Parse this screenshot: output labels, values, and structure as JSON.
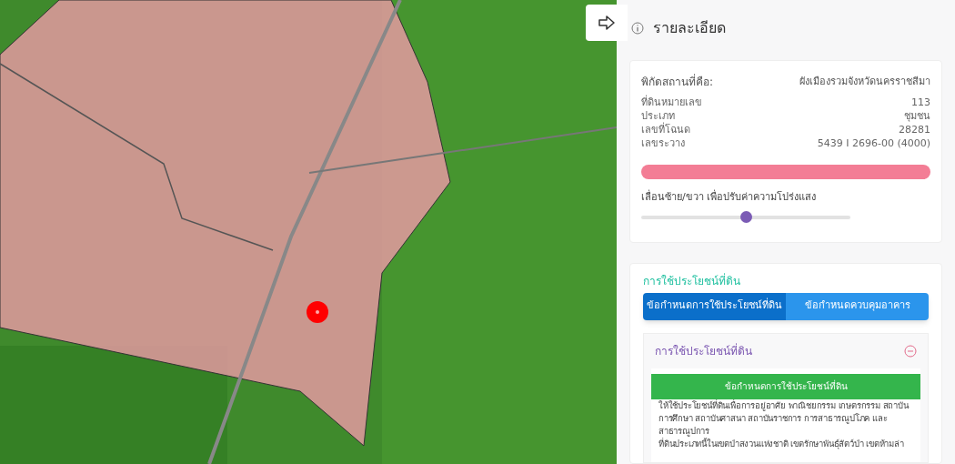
{
  "panel": {
    "title": "รายละเอียด"
  },
  "location": {
    "label": "พิกัดสถานที่คือ:",
    "value": "ผังเมืองรวมจังหวัดนครราชสีมา"
  },
  "details": [
    {
      "label": "ที่ดินหมายเลข",
      "value": "113"
    },
    {
      "label": "ประเภท",
      "value": "ชุมชน"
    },
    {
      "label": "เลขที่โฉนด",
      "value": "28281"
    },
    {
      "label": "เลขระวาง",
      "value": "5439 I 2696-00 (4000)"
    }
  ],
  "opacity": {
    "label": "เลื่อนซ้าย/ขวา เพื่อปรับค่าความโปร่งแสง",
    "level": 0.5
  },
  "land_use": {
    "title": "การใช้ประโยชน์ที่ดิน",
    "tabs": [
      {
        "label": "ข้อกำหนดการใช้ประโยชน์ที่ดิน",
        "selected": true
      },
      {
        "label": "ข้อกำหนดควบคุมอาคาร",
        "selected": false
      }
    ],
    "section": {
      "title": "การใช้ประโยชน์ที่ดิน",
      "expanded": true,
      "heading": "ข้อกำหนดการใช้ประโยชน์ที่ดิน",
      "paragraphs": [
        "ให้ใช้ประโยชน์ที่ดินเพื่อการอยู่อาศัย พาณิชยกรรม เกษตรกรรม สถาบันการศึกษา สถาบันศาสนา สถาบันราชการ การสาธารณูปโภค และสาธารณูปการ",
        "ที่ดินประเภทนี้ในเขตป่าสงวนแห่งชาติ เขตรักษาพันธุ์สัตว์ป่า เขตห้ามล่า"
      ]
    }
  }
}
